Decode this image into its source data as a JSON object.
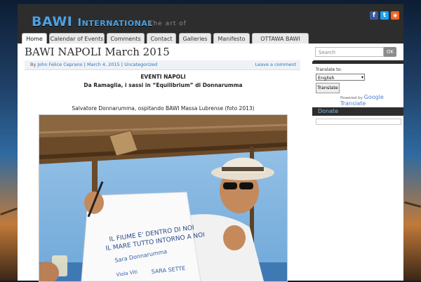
{
  "site": {
    "title_first": "BAWI",
    "title_rest": "International",
    "tagline": "The art of"
  },
  "social": [
    {
      "name": "facebook-icon",
      "glyph": "f",
      "color": "#3b5998"
    },
    {
      "name": "twitter-icon",
      "glyph": "t",
      "color": "#1da1f2"
    },
    {
      "name": "rss-icon",
      "glyph": "◉",
      "color": "#f26522"
    }
  ],
  "nav": {
    "items": [
      "Home",
      "Calendar of Events",
      "Comments",
      "Contact",
      "Galleries",
      "Manifesto",
      "OTTAWA BAWI 2014"
    ],
    "active": "Home"
  },
  "post": {
    "title": "BAWI NAPOLI March 2015",
    "by_prefix": "By",
    "author": "John Felice Ceprano",
    "sep1": "|",
    "date": "March 4, 2015",
    "sep2": "|",
    "category": "Uncategorized",
    "leave_comment": "Leave a comment",
    "heading1": "EVENTI NAPOLI",
    "heading2": "Da Ramaglia, i sassi in “Equilibrium” di Donnarumma",
    "caption": "Salvatore Donnarumma, ospitando BAWI Massa Lubrense  (foto 2013)",
    "shirt_lines": [
      "IL FIUME E' DENTRO DI NOI",
      "IL MARE TUTTO INTORNO A NOI",
      "Sara Donnarumma",
      "SARA SETTE",
      "Viola Viti"
    ]
  },
  "sidebar": {
    "search_placeholder": "Search",
    "search_button": "OK",
    "translate_label": "Translate to:",
    "translate_selected": "English",
    "translate_button": "Translate",
    "powered_by": "Powered by",
    "google_translate": "Google Translate",
    "donate_title": "Donate"
  },
  "colors": {
    "header_bg": "#2d2d2d",
    "logo_blue": "#4aa3e6",
    "link_blue": "#2b74b8"
  }
}
